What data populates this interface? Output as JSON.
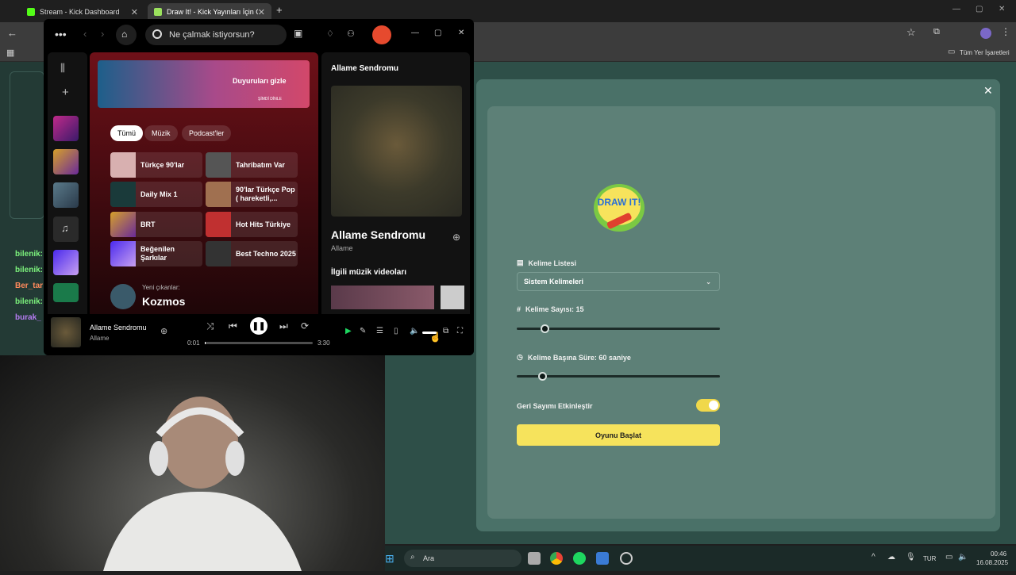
{
  "browser": {
    "tabs": [
      {
        "title": "Stream - Kick Dashboard"
      },
      {
        "title": "Draw It! - Kick Yayınları İçin Çizi"
      }
    ],
    "bookmarks_label": "Tüm Yer İşaretleri"
  },
  "chat": {
    "lines": [
      "bilenik:",
      "bilenik:",
      "Ber_tar",
      "bilenik:",
      "burak_"
    ]
  },
  "game": {
    "word_list_label": "Kelime Listesi",
    "word_list_value": "Sistem Kelimeleri",
    "word_count_label": "Kelime Sayısı: 15",
    "word_count_value": 15,
    "time_label": "Kelime Başına Süre: 60 saniye",
    "time_value": 60,
    "countdown_label": "Geri Sayımı Etkinleştir",
    "countdown_enabled": true,
    "start_button": "Oyunu Başlat",
    "logo_text": "DRAW IT!"
  },
  "spotify": {
    "search_placeholder": "Ne çalmak istiyorsun?",
    "banner_text": "Duyuruları gizle",
    "banner_sub": "ŞİMDİ DİNLE",
    "chips": [
      "Tümü",
      "Müzik",
      "Podcast'ler"
    ],
    "cards": [
      {
        "label": "Türkçe 90'lar"
      },
      {
        "label": "Tahribatım Var"
      },
      {
        "label": "Daily Mix 1"
      },
      {
        "label": "90'lar Türkçe Pop ( hareketli,..."
      },
      {
        "label": "BRT"
      },
      {
        "label": "Hot Hits Türkiye"
      },
      {
        "label": "Beğenilen Şarkılar"
      },
      {
        "label": "Best Techno 2025"
      }
    ],
    "new_release_label": "Yeni çıkanlar:",
    "new_release_title": "Kozmos",
    "right_panel_title": "Allame Sendromu",
    "album_title": "Allame Sendromu",
    "album_artist": "Allame",
    "related_videos": "İlgili müzik videoları",
    "now_playing_title": "Allame Sendromu",
    "now_playing_artist": "Allame",
    "time_current": "0:01",
    "time_total": "3:30",
    "progress": 0.005
  },
  "taskbar": {
    "search": "Ara",
    "lang": "TUR",
    "time": "00:46",
    "date": "16.08.2025"
  }
}
